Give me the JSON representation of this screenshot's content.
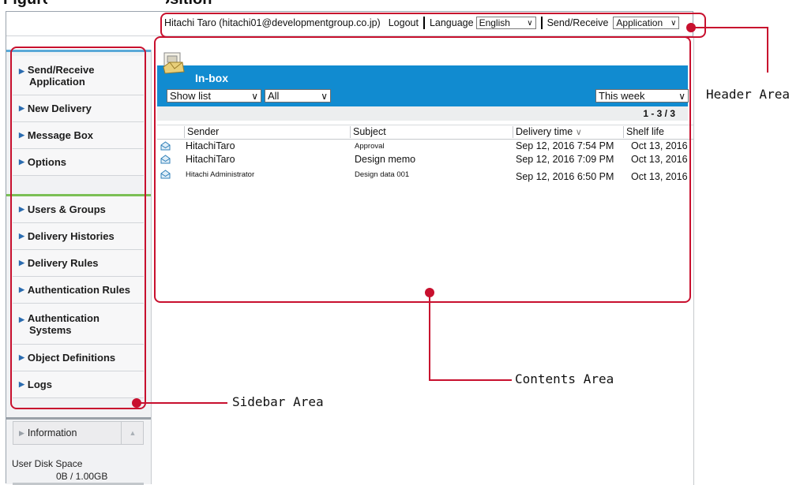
{
  "caption": "Figure: Screen composition",
  "header": {
    "user": "Hitachi Taro (hitachi01@developmentgroup.co.jp)",
    "logout": "Logout",
    "language_label": "Language",
    "language_value": "English",
    "sendreceive_label": "Send/Receive",
    "sendreceive_value": "Application"
  },
  "sidebar": {
    "items": [
      {
        "line1": "Send/Receive",
        "line2": "Application"
      },
      {
        "line1": "New Delivery"
      },
      {
        "line1": "Message Box"
      },
      {
        "line1": "Options"
      },
      {
        "line1": "Users & Groups"
      },
      {
        "line1": "Delivery Histories"
      },
      {
        "line1": "Delivery Rules"
      },
      {
        "line1": "Authentication Rules"
      },
      {
        "line1": "Authentication",
        "line2": "Systems"
      },
      {
        "line1": "Object Definitions"
      },
      {
        "line1": "Logs"
      }
    ],
    "information": "Information",
    "disk_label": "User Disk Space",
    "disk_value": "0B / 1.00GB"
  },
  "content": {
    "title": "In-box",
    "filter_view": "Show list",
    "filter_type": "All",
    "filter_period": "This week",
    "count": "1 - 3 / 3",
    "columns": [
      "Sender",
      "Subject",
      "Delivery time",
      "Shelf life"
    ],
    "sort_indicator": "∨",
    "rows": [
      {
        "sender": "HitachiTaro",
        "subject": "Approval",
        "time": "Sep 12, 2016 7:54 PM",
        "shelf": "Oct 13, 2016"
      },
      {
        "sender": "HitachiTaro",
        "subject": "Design memo",
        "time": "Sep 12, 2016 7:09 PM",
        "shelf": "Oct 13, 2016"
      },
      {
        "sender": "Hitachi Administrator",
        "subject": "Design data 001",
        "time": "Sep 12, 2016 6:50 PM",
        "shelf": "Oct 13, 2016"
      }
    ]
  },
  "annotations": {
    "header": "Header Area",
    "contents": "Contents Area",
    "sidebar": "Sidebar Area"
  },
  "colors": {
    "accent": "#118bd0",
    "annotation": "#c8102e",
    "sidebar_green": "#7bbf55"
  },
  "icons": [
    "envelope-open-icon",
    "inbox-icon",
    "chevron-down-icon",
    "triangle-right-icon",
    "triangle-up-icon"
  ]
}
